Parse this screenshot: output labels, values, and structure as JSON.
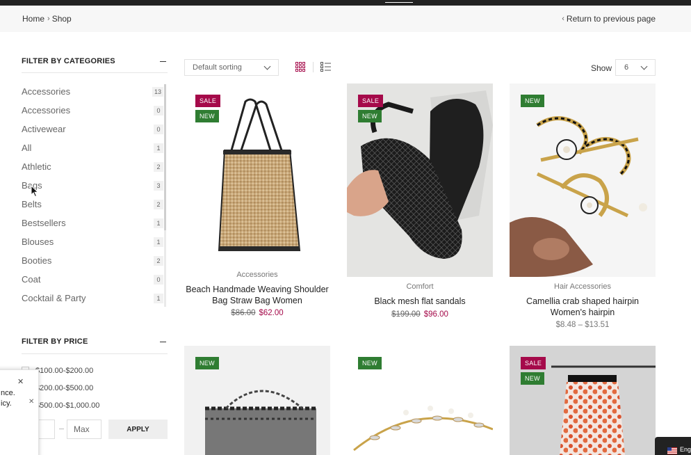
{
  "breadcrumb": {
    "home": "Home",
    "current": "Shop"
  },
  "back_link": "Return to previous page",
  "filter_categories": {
    "title": "FILTER BY CATEGORIES",
    "items": [
      {
        "label": "Accessories",
        "count": "13"
      },
      {
        "label": "Accessories",
        "count": "0"
      },
      {
        "label": "Activewear",
        "count": "0"
      },
      {
        "label": "All",
        "count": "1"
      },
      {
        "label": "Athletic",
        "count": "2"
      },
      {
        "label": "Bags",
        "count": "3"
      },
      {
        "label": "Belts",
        "count": "2"
      },
      {
        "label": "Bestsellers",
        "count": "1"
      },
      {
        "label": "Blouses",
        "count": "1"
      },
      {
        "label": "Booties",
        "count": "2"
      },
      {
        "label": "Coat",
        "count": "0"
      },
      {
        "label": "Cocktail & Party",
        "count": "1"
      }
    ]
  },
  "filter_price": {
    "title": "FILTER BY PRICE",
    "ranges": [
      "$100.00-$200.00",
      "$200.00-$500.00",
      "$500.00-$1,000.00"
    ],
    "min_placeholder": "n",
    "max_placeholder": "Max",
    "apply_label": "APPLY"
  },
  "cookie_popup": {
    "line1": "nce.",
    "line2": "icy."
  },
  "toolbar": {
    "sort_value": "Default sorting",
    "show_label": "Show",
    "show_value": "6"
  },
  "badges": {
    "sale": "SALE",
    "new": "NEW"
  },
  "products": [
    {
      "category": "Accessories",
      "title": "Beach Handmade Weaving Shoulder Bag Straw Bag Women",
      "old_price": "$86.00",
      "price": "$62.00",
      "sale": true,
      "new": true
    },
    {
      "category": "Comfort",
      "title": "Black mesh flat sandals",
      "old_price": "$199.00",
      "price": "$96.00",
      "sale": true,
      "new": true
    },
    {
      "category": "Hair Accessories",
      "title": "Camellia crab shaped hairpin Women's hairpin",
      "price_range": "$8.48 – $13.51",
      "sale": false,
      "new": true
    },
    {
      "new": true,
      "sale": false
    },
    {
      "new": true,
      "sale": false
    },
    {
      "new": true,
      "sale": true
    }
  ],
  "language": "Eng",
  "colors": {
    "sale": "#a50a4a",
    "new": "#2f7d32",
    "accent": "#a50a4a"
  }
}
